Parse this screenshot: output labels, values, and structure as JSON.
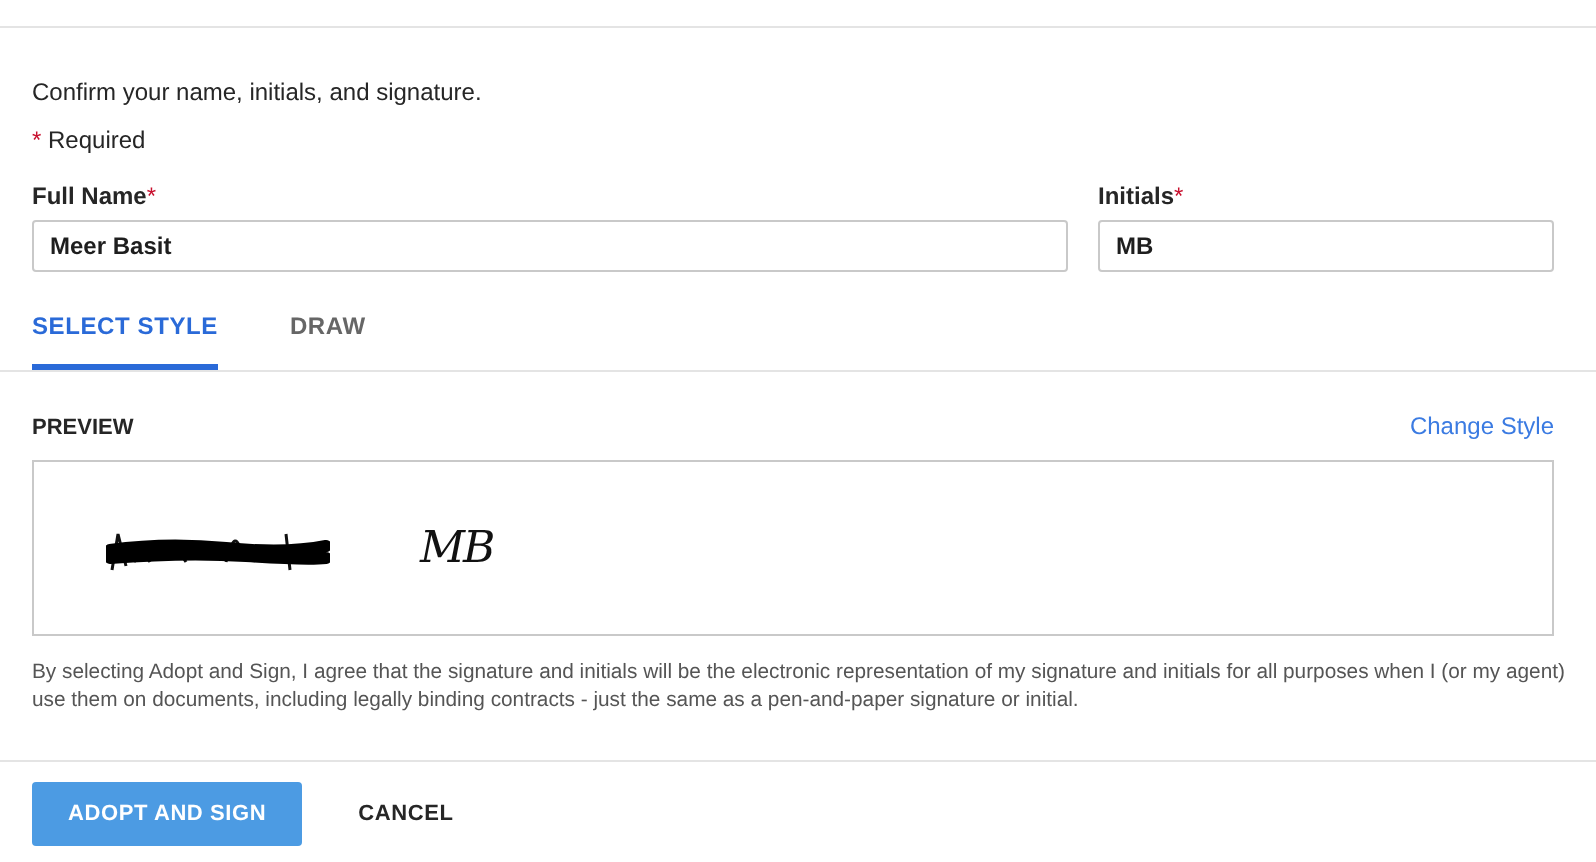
{
  "instructions": "Confirm your name, initials, and signature.",
  "required_note": {
    "mark": "*",
    "text": "Required"
  },
  "fields": [
    {
      "label": "Full Name",
      "required_mark": "*",
      "value": "Meer Basit"
    },
    {
      "label": "Initials",
      "required_mark": "*",
      "value": "MB"
    }
  ],
  "tabs": [
    {
      "label": "SELECT STYLE",
      "selected": true
    },
    {
      "label": "DRAW",
      "selected": false
    }
  ],
  "preview": {
    "heading": "PREVIEW",
    "link": "Change Style",
    "initials": "MB"
  },
  "consent": "By selecting Adopt and Sign, I agree that the signature and initials will be the electronic representation of my signature and initials for all purposes when I (or my agent) use them on documents, including legally binding contracts - just the same as a pen-and-paper signature or initial.",
  "buttons": [
    {
      "label": "ADOPT AND SIGN",
      "kind": "primary"
    },
    {
      "label": "CANCEL",
      "kind": "plain"
    }
  ]
}
